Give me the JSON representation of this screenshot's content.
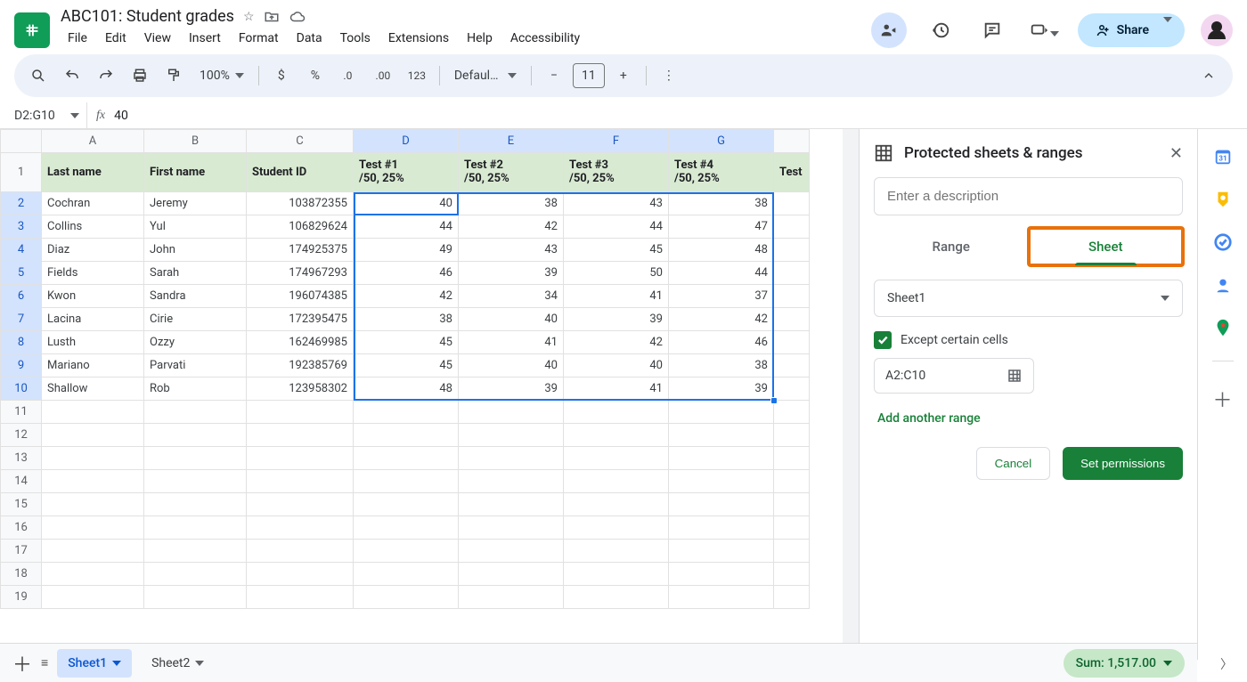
{
  "doc": {
    "title": "ABC101: Student grades"
  },
  "menus": [
    "File",
    "Edit",
    "View",
    "Insert",
    "Format",
    "Data",
    "Tools",
    "Extensions",
    "Help",
    "Accessibility"
  ],
  "toolbar": {
    "zoom": "100%",
    "font": "Defaul…",
    "font_size": "11"
  },
  "namebox": "D2:G10",
  "fx_value": "40",
  "columns": [
    "A",
    "B",
    "C",
    "D",
    "E",
    "F",
    "G"
  ],
  "partial_col_h": "Test",
  "row_numbers": [
    1,
    2,
    3,
    4,
    5,
    6,
    7,
    8,
    9,
    10,
    11,
    12,
    13,
    14,
    15,
    16,
    17,
    18,
    19
  ],
  "header_row": {
    "A": "Last name",
    "B": "First name",
    "C": "Student ID",
    "D": {
      "l1": "Test #1",
      "l2": "/50, 25%"
    },
    "E": {
      "l1": "Test #2",
      "l2": "/50, 25%"
    },
    "F": {
      "l1": "Test #3",
      "l2": "/50, 25%"
    },
    "G": {
      "l1": "Test #4",
      "l2": "/50, 25%"
    }
  },
  "rows": [
    {
      "A": "Cochran",
      "B": "Jeremy",
      "C": "103872355",
      "D": 40,
      "E": 38,
      "F": 43,
      "G": 38
    },
    {
      "A": "Collins",
      "B": "Yul",
      "C": "106829624",
      "D": 44,
      "E": 42,
      "F": 44,
      "G": 47
    },
    {
      "A": "Diaz",
      "B": "John",
      "C": "174925375",
      "D": 49,
      "E": 43,
      "F": 45,
      "G": 48
    },
    {
      "A": "Fields",
      "B": "Sarah",
      "C": "174967293",
      "D": 46,
      "E": 39,
      "F": 50,
      "G": 44
    },
    {
      "A": "Kwon",
      "B": "Sandra",
      "C": "196074385",
      "D": 42,
      "E": 34,
      "F": 41,
      "G": 37
    },
    {
      "A": "Lacina",
      "B": "Cirie",
      "C": "172395475",
      "D": 38,
      "E": 40,
      "F": 39,
      "G": 42
    },
    {
      "A": "Lusth",
      "B": "Ozzy",
      "C": "162469985",
      "D": 45,
      "E": 41,
      "F": 42,
      "G": 46
    },
    {
      "A": "Mariano",
      "B": "Parvati",
      "C": "192385769",
      "D": 45,
      "E": 40,
      "F": 40,
      "G": 38
    },
    {
      "A": "Shallow",
      "B": "Rob",
      "C": "123958302",
      "D": 48,
      "E": 39,
      "F": 41,
      "G": 39
    }
  ],
  "panel": {
    "title": "Protected sheets & ranges",
    "desc_placeholder": "Enter a description",
    "tab_range": "Range",
    "tab_sheet": "Sheet",
    "sheet_selected": "Sheet1",
    "except_label": "Except certain cells",
    "except_range": "A2:C10",
    "add_range": "Add another range",
    "cancel": "Cancel",
    "set_perms": "Set permissions"
  },
  "tabs": {
    "active": "Sheet1",
    "other": "Sheet2"
  },
  "share_label": "Share",
  "sum_chip": "Sum: 1,517.00"
}
